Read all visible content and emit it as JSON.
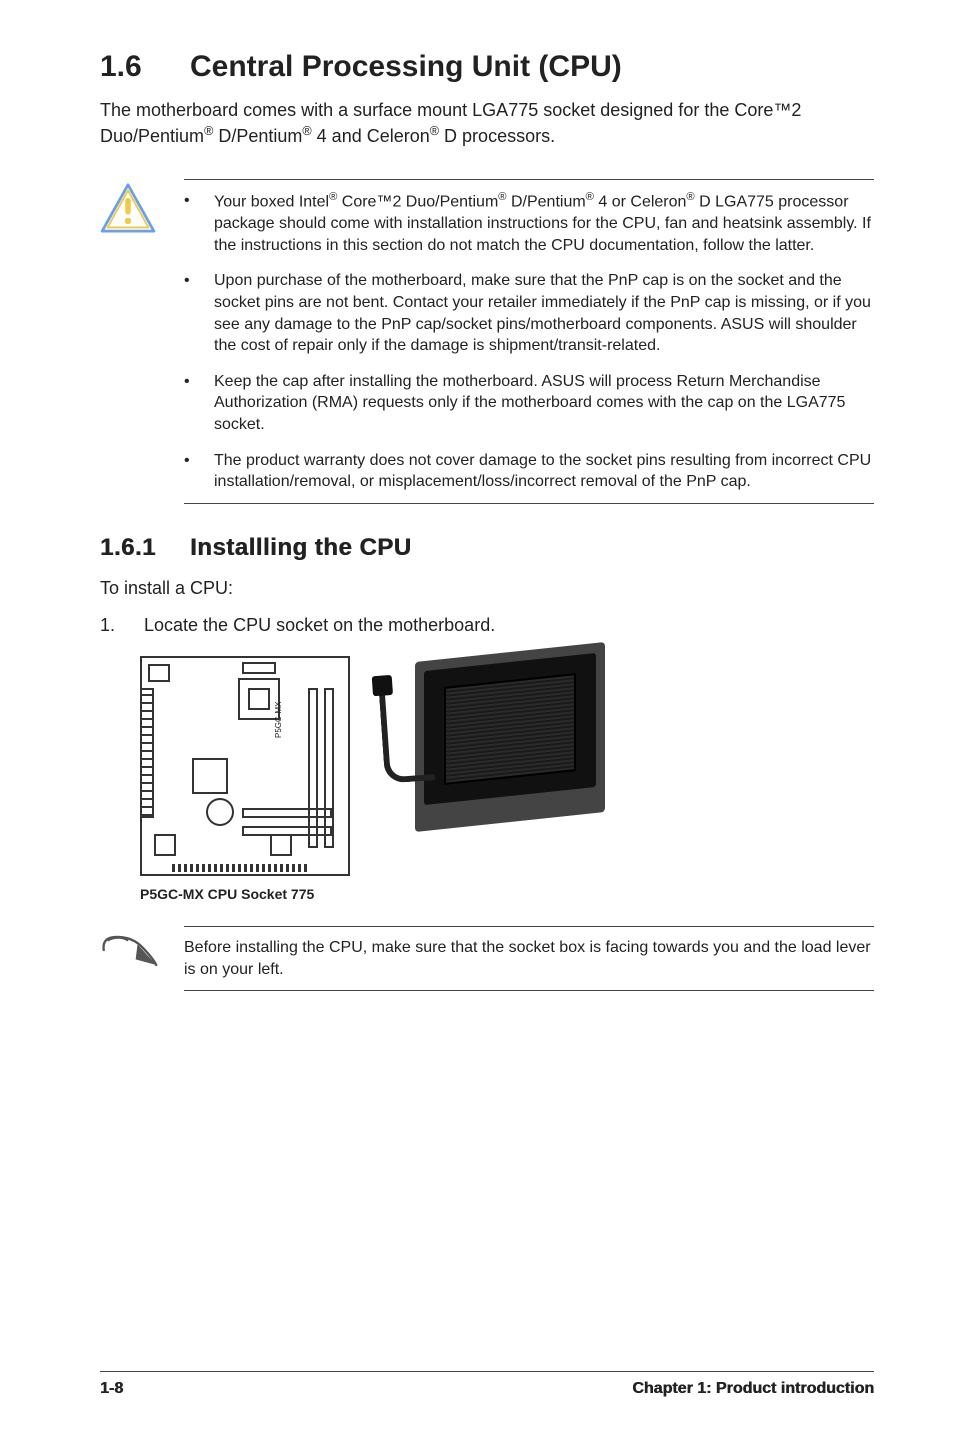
{
  "heading": {
    "num": "1.6",
    "title": "Central Processing Unit (CPU)"
  },
  "intro_parts": {
    "p1": "The motherboard comes with a surface mount LGA775 socket designed for the Core™2 Duo/Pentium",
    "p2": " D/Pentium",
    "p3": " 4 and Celeron",
    "p4": " D processors."
  },
  "reg": "®",
  "warnings": [
    {
      "pre": "Your boxed Intel",
      "mid1": " Core™2 Duo/Pentium",
      "mid2": " D/Pentium",
      "mid3": " 4 or Celeron",
      "tail": " D LGA775 processor package should come with installation instructions for the CPU, fan and heatsink assembly. If the instructions in this section do not match the CPU documentation, follow the latter."
    },
    {
      "text": "Upon purchase of the motherboard, make sure that the PnP cap is on the socket and the socket pins are not bent. Contact your retailer immediately if the PnP cap is missing, or if you see any damage to the PnP cap/socket pins/motherboard components. ASUS will shoulder the cost of repair only if the damage is shipment/transit-related."
    },
    {
      "text": "Keep the cap after installing the motherboard. ASUS will process Return Merchandise Authorization (RMA) requests only if the motherboard comes with the cap on the LGA775 socket."
    },
    {
      "text": "The product warranty does not cover damage to the socket pins resulting from incorrect CPU installation/removal, or misplacement/loss/incorrect removal of the PnP cap."
    }
  ],
  "subheading": {
    "num": "1.6.1",
    "title": "Installling the CPU"
  },
  "lead": "To install a CPU:",
  "step1": {
    "num": "1.",
    "text": "Locate the CPU socket on the motherboard."
  },
  "board_label": "P5GC-MX",
  "caption": "P5GC-MX CPU Socket 775",
  "note": "Before installing the CPU, make sure that the socket box is facing towards you and the load lever is on your left.",
  "footer": {
    "page": "1-8",
    "chapter": "Chapter 1: Product introduction"
  }
}
